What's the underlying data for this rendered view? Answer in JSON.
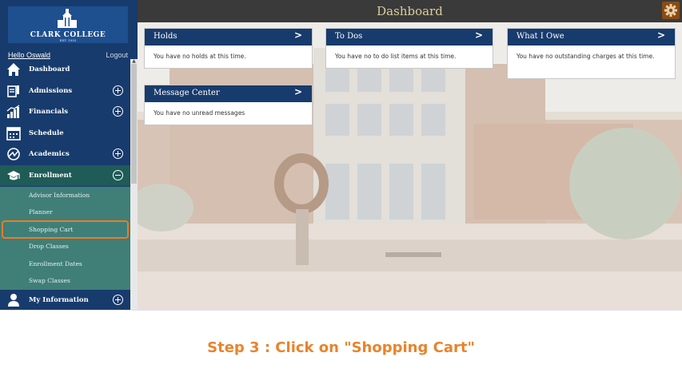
{
  "sidebar": {
    "logo": {
      "name": "CLARK COLLEGE",
      "established": "EST. 1933"
    },
    "greeting": "Hello Oswald",
    "logout": "Logout",
    "items": [
      {
        "label": "Dashboard",
        "icon": "home-icon",
        "toggle": "none"
      },
      {
        "label": "Admissions",
        "icon": "admissions-icon",
        "toggle": "plus"
      },
      {
        "label": "Financials",
        "icon": "financials-icon",
        "toggle": "plus"
      },
      {
        "label": "Schedule",
        "icon": "calendar-icon",
        "toggle": "none"
      },
      {
        "label": "Academics",
        "icon": "academics-icon",
        "toggle": "plus"
      },
      {
        "label": "Enrollment",
        "icon": "graduation-cap-icon",
        "toggle": "minus"
      },
      {
        "label": "My Information",
        "icon": "person-icon",
        "toggle": "plus"
      }
    ],
    "enrollment_submenu": [
      "Advisor Information",
      "Planner",
      "Shopping Cart",
      "Drop Classes",
      "Enrollment Dates",
      "Swap Classes"
    ],
    "highlighted_item": "Shopping Cart"
  },
  "topbar": {
    "title": "Dashboard",
    "settings_icon": "gear-icon"
  },
  "cards": {
    "holds": {
      "title": "Holds",
      "body": "You have no holds at this time."
    },
    "todos": {
      "title": "To Dos",
      "body": "You have no to do list items at this time."
    },
    "owe": {
      "title": "What I Owe",
      "body": "You have no outstanding charges at this time."
    },
    "messages": {
      "title": "Message Center",
      "body": "You have no unread messages"
    },
    "chevron": ">"
  },
  "caption": "Step 3 : Click on \"Shopping Cart\"",
  "colors": {
    "navy": "#173b6c",
    "teal_open": "#1f5b57",
    "submenu": "#3f7f78",
    "highlight": "#f07b22",
    "caption": "#e8842c",
    "topbar": "#3a3a3a",
    "gear_button": "#8a4b14"
  }
}
